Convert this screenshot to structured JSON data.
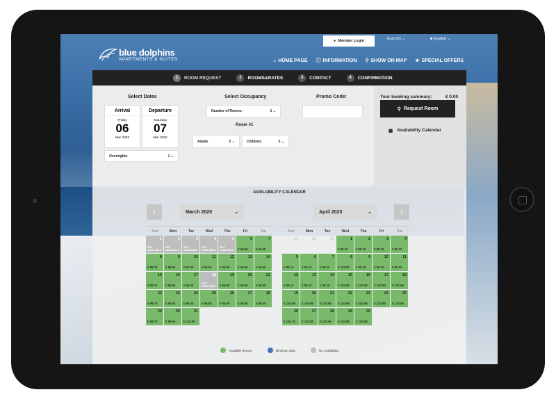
{
  "header": {
    "member_login": "Member Login",
    "currency": "Euro (€)",
    "language": "English",
    "logo_line1": "blue dolphins",
    "logo_line2": "APARTMENTS & SUITES",
    "nav": [
      "HOME PAGE",
      "INFORMATION",
      "SHOW ON MAP",
      "SPECIAL OFFERS"
    ]
  },
  "steps": [
    {
      "num": "1",
      "label": "ROOM REQUEST"
    },
    {
      "num": "2",
      "label": "ROOMS&RATES"
    },
    {
      "num": "3",
      "label": "CONTACT"
    },
    {
      "num": "4",
      "label": "CONFIRMATION"
    }
  ],
  "booking": {
    "select_dates": "Select Dates",
    "arrival": {
      "label": "Arrival",
      "weekday": "Friday",
      "day": "06",
      "month": "Mar 2020"
    },
    "departure": {
      "label": "Departure",
      "weekday": "Saturday",
      "day": "07",
      "month": "Mar 2020"
    },
    "overnights_label": "Overnights",
    "overnights_value": "1",
    "select_occupancy": "Select Occupancy",
    "rooms_label": "Number of Rooms:",
    "rooms_value": "1",
    "room_title": "Room #1",
    "adults_label": "Adults",
    "adults_value": "2",
    "children_label": "Children:",
    "children_value": "0",
    "promo_label": "Promo Code:",
    "promo_value": "",
    "summary_label": "Your booking summary:",
    "summary_value": "€ 0.00",
    "request_button": "Request Room",
    "availability_link": "Availability Calendar"
  },
  "calendar": {
    "title": "AVAILABILITY CALENDAR",
    "months": [
      {
        "label": "March 2020",
        "days": [
          {
            "d": "1",
            "s": "na",
            "p": "NOT AVAILABLE"
          },
          {
            "d": "2",
            "s": "na",
            "p": "NOT AVAILABLE"
          },
          {
            "d": "3",
            "s": "na",
            "p": "NOT AVAILABLE"
          },
          {
            "d": "4",
            "s": "na",
            "p": "NOT AVAILABLE"
          },
          {
            "d": "5",
            "s": "na",
            "p": "NOT AVAILABLE"
          },
          {
            "d": "6",
            "s": "av",
            "p": "€ 66.50"
          },
          {
            "d": "7",
            "s": "av",
            "p": "€ 66.50"
          },
          {
            "d": "8",
            "s": "av",
            "p": "€ 99.75"
          },
          {
            "d": "9",
            "s": "av",
            "p": "€ 66.50"
          },
          {
            "d": "10",
            "s": "av",
            "p": "€ 57.00"
          },
          {
            "d": "11",
            "s": "av",
            "p": "€ 66.50"
          },
          {
            "d": "12",
            "s": "av",
            "p": "€ 66.50"
          },
          {
            "d": "13",
            "s": "av",
            "p": "€ 66.50"
          },
          {
            "d": "14",
            "s": "av",
            "p": "€ 66.50"
          },
          {
            "d": "15",
            "s": "av",
            "p": "€ 99.75"
          },
          {
            "d": "16",
            "s": "av",
            "p": "€ 66.50"
          },
          {
            "d": "17",
            "s": "av",
            "p": "€ 66.50"
          },
          {
            "d": "18",
            "s": "na",
            "p": "NOT AVAILABLE"
          },
          {
            "d": "19",
            "s": "av",
            "p": "€ 66.50"
          },
          {
            "d": "20",
            "s": "av",
            "p": "€ 66.50"
          },
          {
            "d": "21",
            "s": "av",
            "p": "€ 66.50"
          },
          {
            "d": "22",
            "s": "av",
            "p": "€ 99.75"
          },
          {
            "d": "23",
            "s": "av",
            "p": "€ 66.50"
          },
          {
            "d": "24",
            "s": "av",
            "p": "€ 66.50"
          },
          {
            "d": "25",
            "s": "av",
            "p": "€ 66.50"
          },
          {
            "d": "26",
            "s": "av",
            "p": "€ 66.50"
          },
          {
            "d": "27",
            "s": "av",
            "p": "€ 66.50"
          },
          {
            "d": "28",
            "s": "av",
            "p": "€ 66.50"
          },
          {
            "d": "29",
            "s": "av",
            "p": "€ 99.75"
          },
          {
            "d": "30",
            "s": "av",
            "p": "€ 66.50"
          },
          {
            "d": "31",
            "s": "av",
            "p": "€ 114.00"
          }
        ]
      },
      {
        "label": "April 2020",
        "lead": [
          {
            "d": "29",
            "s": "fa",
            "p": ""
          },
          {
            "d": "30",
            "s": "fa",
            "p": ""
          },
          {
            "d": "31",
            "s": "fa",
            "p": ""
          }
        ],
        "days": [
          {
            "d": "1",
            "s": "av",
            "p": "€ 95.10"
          },
          {
            "d": "2",
            "s": "av",
            "p": "€ 95.10"
          },
          {
            "d": "3",
            "s": "av",
            "p": "€ 95.10"
          },
          {
            "d": "4",
            "s": "av",
            "p": "€ 95.10"
          },
          {
            "d": "5",
            "s": "av",
            "p": "€ 95.10"
          },
          {
            "d": "6",
            "s": "av",
            "p": "€ 95.10"
          },
          {
            "d": "7",
            "s": "av",
            "p": "€ 95.10"
          },
          {
            "d": "8",
            "s": "av",
            "p": "€ 133.00"
          },
          {
            "d": "9",
            "s": "av",
            "p": "€ 95.10"
          },
          {
            "d": "10",
            "s": "av",
            "p": "€ 95.10"
          },
          {
            "d": "11",
            "s": "av",
            "p": "€ 95.10"
          },
          {
            "d": "12",
            "s": "av",
            "p": "€ 95.10"
          },
          {
            "d": "13",
            "s": "av",
            "p": "€ 95.10"
          },
          {
            "d": "14",
            "s": "av",
            "p": "€ 95.10"
          },
          {
            "d": "15",
            "s": "av",
            "p": "€ 120.65"
          },
          {
            "d": "16",
            "s": "av",
            "p": "€ 120.65"
          },
          {
            "d": "17",
            "s": "av",
            "p": "€ 120.65"
          },
          {
            "d": "18",
            "s": "av",
            "p": "€ 120.65"
          },
          {
            "d": "19",
            "s": "av",
            "p": "€ 120.65"
          },
          {
            "d": "20",
            "s": "av",
            "p": "€ 120.65"
          },
          {
            "d": "21",
            "s": "av",
            "p": "€ 120.65"
          },
          {
            "d": "22",
            "s": "av",
            "p": "€ 120.65"
          },
          {
            "d": "23",
            "s": "av",
            "p": "€ 120.65"
          },
          {
            "d": "24",
            "s": "av",
            "p": "€ 120.65"
          },
          {
            "d": "25",
            "s": "av",
            "p": "€ 120.65"
          },
          {
            "d": "26",
            "s": "av",
            "p": "€ 194.75"
          },
          {
            "d": "27",
            "s": "av",
            "p": "€ 120.65"
          },
          {
            "d": "28",
            "s": "av",
            "p": "€ 120.65"
          },
          {
            "d": "29",
            "s": "av",
            "p": "€ 120.65"
          },
          {
            "d": "30",
            "s": "av",
            "p": "€ 120.65"
          }
        ]
      }
    ],
    "weekdays": [
      "Sun",
      "Mon",
      "Tue",
      "Wed",
      "Thu",
      "Fri",
      "Sat"
    ],
    "legend": [
      {
        "label": "Available Rooms",
        "color": "#79b96a"
      },
      {
        "label": "Minimum Stay",
        "color": "#3f74b5"
      },
      {
        "label": "No Availability",
        "color": "#bdbdbd"
      }
    ]
  }
}
